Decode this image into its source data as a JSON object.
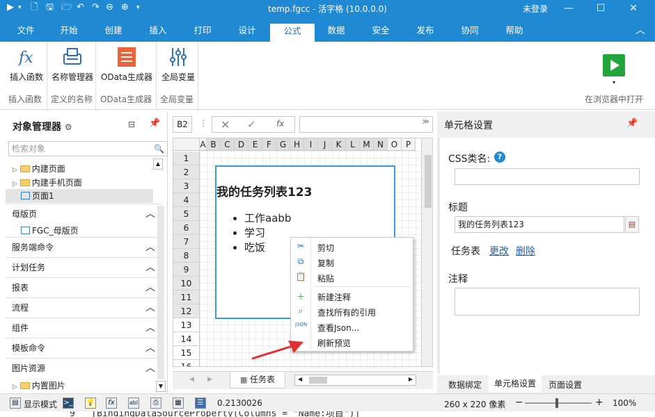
{
  "titlebar": {
    "title": "temp.fgcc - 活字格 (10.0.0.0)",
    "login": "未登录"
  },
  "menu": {
    "tabs": [
      "文件",
      "开始",
      "创建",
      "插入",
      "打印",
      "设计",
      "公式",
      "数据",
      "安全",
      "发布",
      "协同",
      "帮助"
    ],
    "active": "公式"
  },
  "ribbon": {
    "insert_func_label": "插入函数",
    "name_manager_label": "名称管理器",
    "odata_label": "OData生成器",
    "global_var_label": "全局变量",
    "group_insert_func": "插入函数",
    "group_defined_names": "定义的名称",
    "group_odata": "OData生成器",
    "group_global_var": "全局变量",
    "open_in_browser": "在浏览器中打开"
  },
  "left_pane": {
    "title": "对象管理器",
    "search_placeholder": "检索对象",
    "tree": [
      "内建页面",
      "内建手机页面",
      "页面1"
    ],
    "sections": [
      {
        "label": "母版页",
        "children": [
          "FGC_母版页"
        ]
      },
      {
        "label": "服务端命令"
      },
      {
        "label": "计划任务"
      },
      {
        "label": "报表"
      },
      {
        "label": "流程"
      },
      {
        "label": "组件"
      },
      {
        "label": "模板命令"
      },
      {
        "label": "图片资源",
        "children": [
          "内置图片"
        ]
      }
    ]
  },
  "formula_bar": {
    "cell_ref": "B2",
    "fx": "fx"
  },
  "grid": {
    "columns": [
      "A",
      "B",
      "C",
      "D",
      "E",
      "F",
      "G",
      "H",
      "I",
      "J",
      "K",
      "L",
      "M",
      "N",
      "O",
      "P"
    ],
    "rows": [
      "1",
      "2",
      "3",
      "4",
      "5",
      "6",
      "7",
      "8",
      "9",
      "10",
      "11",
      "12",
      "13",
      "14",
      "15",
      "16"
    ],
    "cell_title": "我的任务列表123",
    "list_items": [
      "工作aabb",
      "学习",
      "吃饭"
    ],
    "sheet_tab": "任务表"
  },
  "context_menu": {
    "items": [
      "剪切",
      "复制",
      "粘贴",
      "新建注释",
      "查找所有的引用",
      "查看Json...",
      "刷新预览"
    ]
  },
  "right_pane": {
    "title": "单元格设置",
    "css_label": "CSS类名:",
    "css_value": "",
    "title_label": "标题",
    "title_value": "我的任务列表123",
    "table_label": "任务表",
    "edit_link": "更改",
    "delete_link": "删除",
    "note_label": "注释",
    "tabs": [
      "数据绑定",
      "单元格设置",
      "页面设置"
    ]
  },
  "statusbar": {
    "display_mode": "显示模式",
    "value": "0.2130026",
    "size": "260 x 220 像素",
    "zoom": "100%"
  },
  "code_peek": "9   [BindingDataSourceProperty(Columns = \"Name:项目\")]"
}
